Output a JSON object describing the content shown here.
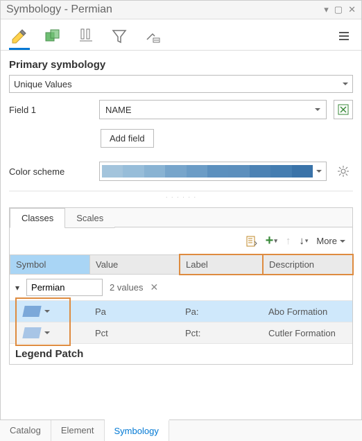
{
  "window": {
    "title": "Symbology - Permian"
  },
  "primary": {
    "heading": "Primary symbology",
    "method": "Unique Values"
  },
  "field": {
    "label": "Field 1",
    "value": "NAME",
    "add_button": "Add field"
  },
  "color": {
    "label": "Color scheme",
    "swatches": [
      "#a3c4dc",
      "#97bdd9",
      "#89b3d3",
      "#77a5cb",
      "#6b9cc6",
      "#5c90be",
      "#5c8fbd",
      "#4c82b4",
      "#447db1",
      "#3a73a9"
    ]
  },
  "subtabs": {
    "classes": "Classes",
    "scales": "Scales"
  },
  "toolbar_labels": {
    "more": "More"
  },
  "headers": {
    "symbol": "Symbol",
    "value": "Value",
    "label": "Label",
    "description": "Description"
  },
  "group": {
    "name": "Permian",
    "count_text": "2 values"
  },
  "rows": [
    {
      "value": "Pa",
      "label": "Pa:",
      "description": "Abo Formation"
    },
    {
      "value": "Pct",
      "label": "Pct:",
      "description": "Cutler Formation"
    }
  ],
  "legend_patch": "Legend Patch",
  "bottom_tabs": {
    "catalog": "Catalog",
    "element": "Element",
    "symbology": "Symbology"
  }
}
